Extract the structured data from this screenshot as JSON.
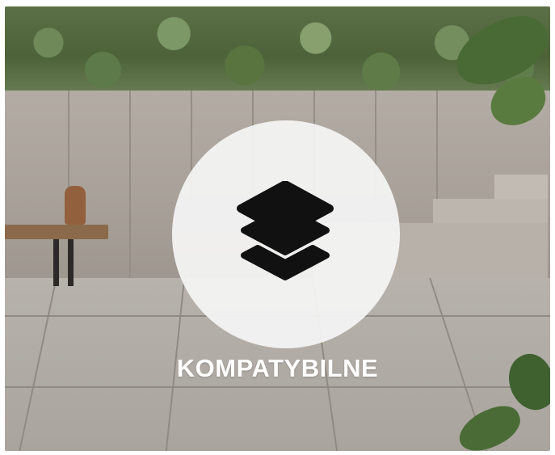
{
  "card": {
    "title": "KOMPATYBILNE",
    "icon": "layers-icon"
  },
  "colors": {
    "overlay_circle": "#f5f5f5",
    "icon": "#111111",
    "title_text": "#ffffff"
  }
}
